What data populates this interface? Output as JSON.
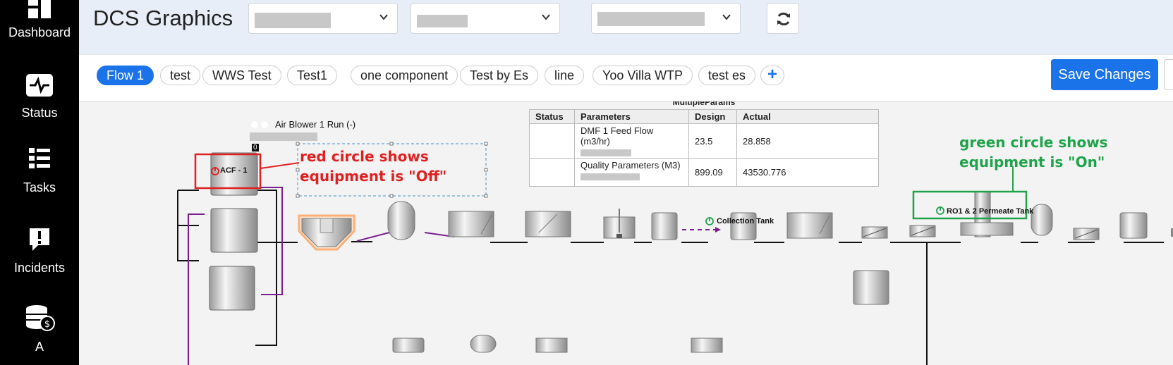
{
  "sidebar": {
    "items": [
      {
        "label": "Dashboard",
        "icon": "dashboard-icon"
      },
      {
        "label": "Status",
        "icon": "pulse-icon"
      },
      {
        "label": "Tasks",
        "icon": "checklist-icon"
      },
      {
        "label": "Incidents",
        "icon": "alert-icon"
      },
      {
        "label": "A",
        "icon": "database-coin-icon"
      }
    ]
  },
  "header": {
    "title": "DCS Graphics",
    "selects": [
      {
        "value": ""
      },
      {
        "value": ""
      },
      {
        "value": ""
      }
    ],
    "refresh_icon": "refresh-icon"
  },
  "tabs": {
    "items": [
      {
        "label": "Flow 1",
        "active": true
      },
      {
        "label": "test"
      },
      {
        "label": "WWS Test"
      },
      {
        "label": "Test1"
      },
      {
        "label": "one component"
      },
      {
        "label": "Test by Es"
      },
      {
        "label": "line"
      },
      {
        "label": "Yoo Villa WTP"
      },
      {
        "label": "test es"
      }
    ],
    "add_label": "+",
    "save_label": "Save Changes"
  },
  "params_table": {
    "title": "MultipleParams",
    "headers": [
      "Status",
      "Parameters",
      "Design",
      "Actual"
    ],
    "rows": [
      {
        "status": "",
        "parameter": "DMF 1 Feed Flow (m3/hr)",
        "design": "23.5",
        "actual": "28.858"
      },
      {
        "status": "",
        "parameter": "Quality Parameters (M3)",
        "design": "899.09",
        "actual": "43530.776"
      }
    ]
  },
  "annotations": {
    "red_note_line1": "red circle shows",
    "red_note_line2": "equipment is \"Off\"",
    "green_note_line1": "green circle shows",
    "green_note_line2": "equipment is \"On\""
  },
  "equipment": {
    "air_blower_label": "Air Blower 1 Run (-)",
    "air_blower_value": "0",
    "acf_label": "ACF - 1",
    "collection_tank_label": "Collection Tank",
    "permeate_tank_label": "RO1 & 2 Permeate Tank"
  },
  "colors": {
    "accent": "#1a73e8",
    "off_red": "#e02020",
    "on_green": "#1fa34a",
    "pipe_purple": "#7a1f8f"
  }
}
